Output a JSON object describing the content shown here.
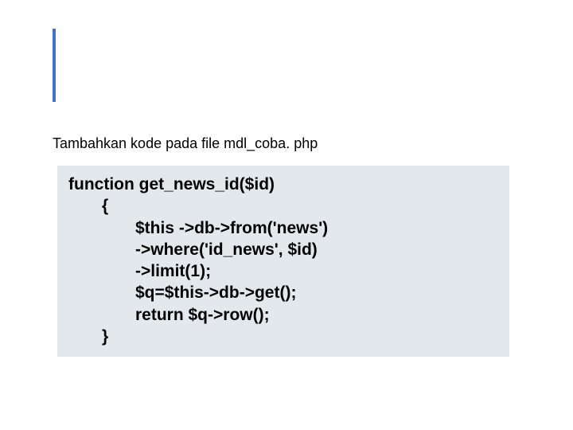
{
  "instruction": "Tambahkan kode pada file mdl_coba. php",
  "code": {
    "line1": "function get_news_id($id)",
    "line2": "{",
    "line3": "$this ->db->from('news')",
    "line4": "->where('id_news', $id)",
    "line5": "->limit(1);",
    "line6": "$q=$this->db->get();",
    "line7": "return $q->row();",
    "line8": "}"
  }
}
